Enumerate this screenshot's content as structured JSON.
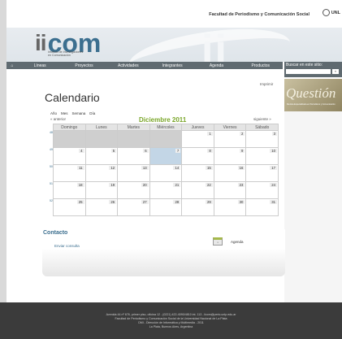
{
  "top": {
    "facultad": "Facultad de Periodismo y Comunicación Social",
    "unlp": "UNL"
  },
  "logo": {
    "ii": "ii",
    "com": "com",
    "subtitle_1": "Instituto de Investigaciones",
    "subtitle_2": "en Comunicación"
  },
  "nav": {
    "home": "⌂",
    "items": [
      "Líneas",
      "Proyectos",
      "Actividades",
      "Integrantes",
      "Agenda",
      "Productos"
    ]
  },
  "search": {
    "label": "Buscar en este sitio:",
    "button": "»"
  },
  "banner": {
    "title": "Questión",
    "subtitle": "Revista Especializada en Periodismo y Comunicación"
  },
  "main": {
    "print": "Imprimir",
    "title": "Calendario",
    "views": [
      "Año",
      "Mes",
      "Semana",
      "Día"
    ],
    "prev": "« anterior",
    "month": "Diciembre 2011",
    "next": "siguiente »"
  },
  "calendar": {
    "headers": [
      "Domingo",
      "Lunes",
      "Martes",
      "Miércoles",
      "Jueves",
      "Viernes",
      "Sábado"
    ],
    "weeks": [
      {
        "wk": "48",
        "days": [
          "",
          "",
          "",
          "",
          "1",
          "2",
          "3"
        ]
      },
      {
        "wk": "49",
        "days": [
          "4",
          "5",
          "6",
          "7",
          "8",
          "9",
          "10"
        ]
      },
      {
        "wk": "50",
        "days": [
          "11",
          "12",
          "13",
          "14",
          "15",
          "16",
          "17"
        ]
      },
      {
        "wk": "51",
        "days": [
          "18",
          "19",
          "20",
          "21",
          "22",
          "23",
          "24"
        ]
      },
      {
        "wk": "52",
        "days": [
          "25",
          "26",
          "27",
          "28",
          "29",
          "30",
          "31"
        ]
      }
    ],
    "today": "7"
  },
  "contact": {
    "title": "Contacto",
    "link": "Enviar consulta",
    "agenda": "Agenda"
  },
  "footer": {
    "line1": "Avenida 44 nº 676, primer piso, oficina 12 - (0221) 422-4090/4810 int. 113 - iicom@perio.unlp.edu.ar",
    "line2": "Facultad de Periodismo y Comunicación Social de la Universidad Nacional de La Plata",
    "line3": "DMI - Dirección de Informática y Multimedia - 2011",
    "line4": "La Plata, Buenos Aires, Argentina"
  }
}
